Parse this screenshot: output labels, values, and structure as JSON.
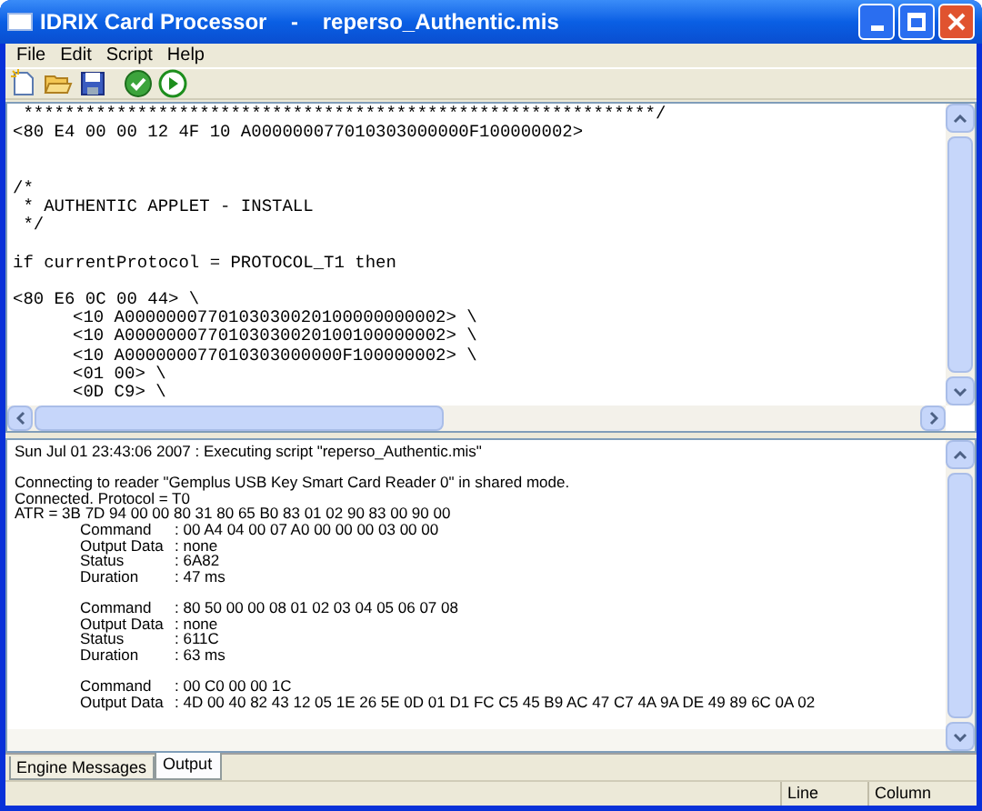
{
  "window": {
    "title": "IDRIX Card Processor    -    reperso_Authentic.mis"
  },
  "menu": [
    "File",
    "Edit",
    "Script",
    "Help"
  ],
  "toolbar": [
    {
      "kind": "new"
    },
    {
      "kind": "open"
    },
    {
      "kind": "save"
    },
    {
      "kind": "check"
    },
    {
      "kind": "run"
    }
  ],
  "editor": {
    "lines": [
      {
        "kind": "code",
        "text": " *************************************************************/"
      },
      {
        "kind": "code",
        "text": "<80 E4 00 00 12 4F 10 A000000077010303000000F100000002>"
      },
      {
        "kind": "blank"
      },
      {
        "kind": "blank"
      },
      {
        "kind": "code",
        "text": "/*"
      },
      {
        "kind": "code",
        "text": " * AUTHENTIC APPLET - INSTALL"
      },
      {
        "kind": "code",
        "text": " */"
      },
      {
        "kind": "blank"
      },
      {
        "kind": "code",
        "text": "if currentProtocol = PROTOCOL_T1 then"
      },
      {
        "kind": "blank"
      },
      {
        "kind": "code",
        "text": "<80 E6 0C 00 44> \\"
      },
      {
        "kind": "indented",
        "text": "<10 A0000000770103030020100000000002> \\"
      },
      {
        "kind": "indented",
        "text": "<10 A0000000770103030020100100000002> \\"
      },
      {
        "kind": "indented",
        "text": "<10 A000000077010303000000F100000002> \\"
      },
      {
        "kind": "indented",
        "text": "<01 00> \\"
      },
      {
        "kind": "indented",
        "text": "<0D C9> \\"
      }
    ]
  },
  "log": {
    "lines": [
      {
        "kind": "text",
        "text": "Sun Jul 01 23:43:06 2007 : Executing script \"reperso_Authentic.mis\""
      },
      {
        "kind": "blank"
      },
      {
        "kind": "text",
        "text": "Connecting to reader \"Gemplus USB Key Smart Card Reader 0\" in shared mode."
      },
      {
        "kind": "text",
        "text": "Connected. Protocol = T0"
      },
      {
        "kind": "text",
        "text": "ATR = 3B 7D 94 00 00 80 31 80 65 B0 83 01 02 90 83 00 90 00"
      },
      {
        "kind": "field",
        "label": "Command",
        "value": ": 00 A4 04 00 07 A0 00 00 00 03 00 00"
      },
      {
        "kind": "field",
        "label": "Output Data",
        "value": ": none"
      },
      {
        "kind": "field",
        "label": "Status",
        "value": ": 6A82"
      },
      {
        "kind": "field",
        "label": "Duration",
        "value": ": 47 ms"
      },
      {
        "kind": "blank"
      },
      {
        "kind": "field",
        "label": "Command",
        "value": ": 80 50 00 00 08 01 02 03 04 05 06 07 08"
      },
      {
        "kind": "field",
        "label": "Output Data",
        "value": ": none"
      },
      {
        "kind": "field",
        "label": "Status",
        "value": ": 611C"
      },
      {
        "kind": "field",
        "label": "Duration",
        "value": ": 63 ms"
      },
      {
        "kind": "blank"
      },
      {
        "kind": "field",
        "label": "Command",
        "value": ": 00 C0 00 00 1C"
      },
      {
        "kind": "field",
        "label": "Output Data",
        "value": ": 4D 00 40 82 43 12 05 1E 26 5E 0D 01 D1 FC C5 45 B9 AC 47 C7 4A 9A DE 49 89 6C 0A 02"
      }
    ]
  },
  "tabs": [
    {
      "label": "Engine Messages",
      "selected": false
    },
    {
      "label": "Output",
      "selected": true
    }
  ],
  "status_bar": [
    "Line",
    "Column"
  ]
}
